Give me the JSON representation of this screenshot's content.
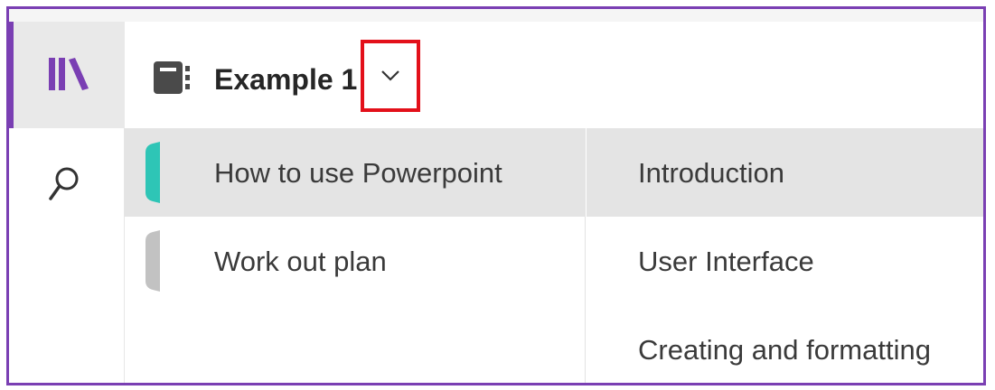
{
  "header": {
    "notebook_title": "Example 1",
    "notebook_icon": "notebook-icon",
    "dropdown_icon": "chevron-down-icon"
  },
  "rail": {
    "items": [
      {
        "icon": "library-icon",
        "active": true
      },
      {
        "icon": "search-icon",
        "active": false
      }
    ]
  },
  "sections": [
    {
      "label": "How to use Powerpoint",
      "color": "#2ec5b6",
      "selected": true
    },
    {
      "label": "Work out plan",
      "color": "#c2c2c2",
      "selected": false
    }
  ],
  "pages": [
    {
      "label": "Introduction",
      "selected": true
    },
    {
      "label": "User Interface",
      "selected": false
    },
    {
      "label": "Creating and formatting",
      "selected": false
    }
  ],
  "colors": {
    "accent": "#7a3fb3",
    "highlight_box": "#e3101a",
    "selected_bg": "#e4e4e4"
  }
}
